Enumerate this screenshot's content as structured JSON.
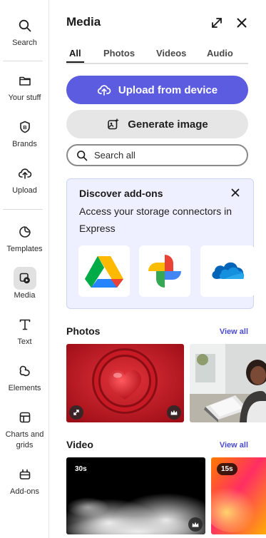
{
  "rail": {
    "items": [
      {
        "label": "Search",
        "icon": "search-icon"
      },
      {
        "label": "Your stuff",
        "icon": "folder-icon"
      },
      {
        "label": "Brands",
        "icon": "brand-icon"
      },
      {
        "label": "Upload",
        "icon": "upload-cloud-icon"
      },
      {
        "label": "Templates",
        "icon": "templates-icon"
      },
      {
        "label": "Media",
        "icon": "media-icon",
        "active": true
      },
      {
        "label": "Text",
        "icon": "text-icon"
      },
      {
        "label": "Elements",
        "icon": "elements-icon"
      },
      {
        "label": "Charts and grids",
        "icon": "charts-grids-icon"
      },
      {
        "label": "Add-ons",
        "icon": "add-ons-icon"
      }
    ]
  },
  "panel": {
    "title": "Media",
    "expand_icon": "expand-icon",
    "close_icon": "close-icon",
    "tabs": [
      {
        "label": "All",
        "active": true
      },
      {
        "label": "Photos"
      },
      {
        "label": "Videos"
      },
      {
        "label": "Audio"
      }
    ],
    "upload_label": "Upload from device",
    "generate_label": "Generate image",
    "search_placeholder": "Search all",
    "addons": {
      "title": "Discover add-ons",
      "description": "Access your storage connectors in Express",
      "connectors": [
        "google-drive-icon",
        "google-photos-icon",
        "onedrive-icon"
      ]
    },
    "photos": {
      "title": "Photos",
      "view_all": "View all"
    },
    "video": {
      "title": "Video",
      "view_all": "View all",
      "items": [
        {
          "duration": "30s"
        },
        {
          "duration": "15s"
        }
      ]
    }
  },
  "colors": {
    "accent": "#5c5ce0",
    "link": "#4b4bd2",
    "addons_bg": "#eff0ff"
  }
}
